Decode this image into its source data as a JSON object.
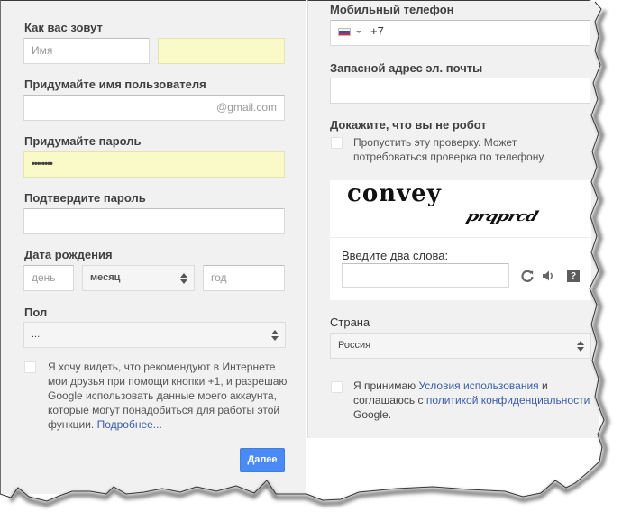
{
  "left": {
    "name": {
      "label": "Как вас зовут",
      "first_placeholder": "Имя",
      "last_value": ""
    },
    "username": {
      "label": "Придумайте имя пользователя",
      "value": "",
      "suffix": "@gmail.com"
    },
    "password": {
      "label": "Придумайте пароль",
      "value": "••••••••"
    },
    "confirm_password": {
      "label": "Подтвердите пароль",
      "value": ""
    },
    "birthdate": {
      "label": "Дата рождения",
      "day_placeholder": "день",
      "month_selected": "месяц",
      "year_placeholder": "год"
    },
    "gender": {
      "label": "Пол",
      "selected": "..."
    },
    "plus_one": {
      "text": "Я хочу видеть, что рекомендуют в Интернете мои друзья при помощи кнопки +1, и разрешаю Google использовать данные моего аккаунта, которые могут понадобиться для работы этой функции.",
      "link": "Подробнее...",
      "checked": false
    },
    "next_button": "Далее"
  },
  "right": {
    "phone": {
      "label": "Мобильный телефон",
      "country_flag": "russia-flag",
      "code": "+7"
    },
    "backup_email": {
      "label": "Запасной адрес эл. почты",
      "value": ""
    },
    "robot": {
      "label": "Докажите, что вы не робот",
      "skip_text": "Пропустить эту проверку. Может потребоваться проверка по телефону.",
      "checked": false
    },
    "captcha": {
      "word1": "convey",
      "word2": "prqprcd",
      "input_label": "Введите два слова:",
      "input_value": "",
      "icons": [
        "reload-icon",
        "audio-icon",
        "help-icon"
      ],
      "help_glyph": "?"
    },
    "country": {
      "label": "Страна",
      "selected": "Россия"
    },
    "terms": {
      "prefix": "Я принимаю ",
      "terms_link": "Условия использования",
      "middle": " и соглашаюсь с ",
      "privacy_link": "политикой конфиденциальности",
      "suffix": " Google.",
      "checked": false
    }
  },
  "colors": {
    "panel_bg": "#f1f1f1",
    "autofill_yellow": "#fafac8",
    "primary_button": "#4a8af4",
    "link": "#3b5ea8"
  }
}
